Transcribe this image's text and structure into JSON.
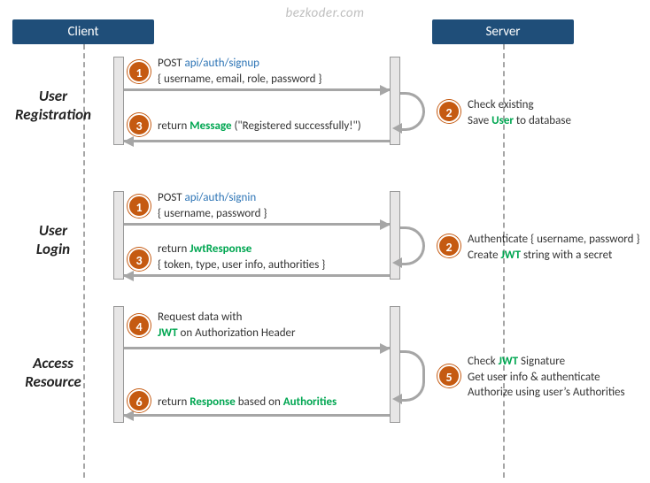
{
  "watermark": "bezkoder.com",
  "lanes": {
    "client": "Client",
    "server": "Server"
  },
  "sections": {
    "registration": {
      "label_line1": "User",
      "label_line2": "Registration"
    },
    "login": {
      "label_line1": "User",
      "label_line2": "Login"
    },
    "access": {
      "label_line1": "Access",
      "label_line2": "Resource"
    }
  },
  "steps": {
    "reg1": {
      "num": "1",
      "prefix": "POST ",
      "endpoint": "api/auth/signup",
      "body": "{ username, email, role, password }"
    },
    "reg2": {
      "num": "2",
      "line1_a": "Check existing",
      "line2_a": "Save ",
      "line2_green": "User",
      "line2_b": " to database"
    },
    "reg3": {
      "num": "3",
      "prefix": "return ",
      "green": "Message",
      "suffix": " (\"Registered successfully!\")"
    },
    "login1": {
      "num": "1",
      "prefix": "POST ",
      "endpoint": "api/auth/signin",
      "body": "{ username, password }"
    },
    "login2": {
      "num": "2",
      "line1_a": "Authenticate { username, password }",
      "line2_a": "Create ",
      "line2_green": "JWT",
      "line2_b": " string with a secret"
    },
    "login3": {
      "num": "3",
      "prefix": "return ",
      "green": "JwtResponse",
      "body": "{ token, type, user info, authorities }"
    },
    "acc4": {
      "num": "4",
      "line1": "Request  data with",
      "line2_green": "JWT",
      "line2_b": " on Authorization Header"
    },
    "acc5": {
      "num": "5",
      "line1_a": "Check ",
      "line1_green": "JWT",
      "line1_b": " Signature",
      "line2": "Get user info & authenticate",
      "line3": "Authorize using user’s Authorities"
    },
    "acc6": {
      "num": "6",
      "prefix": "return ",
      "green": "Response",
      "mid": " based on ",
      "green2": "Authorities"
    }
  }
}
